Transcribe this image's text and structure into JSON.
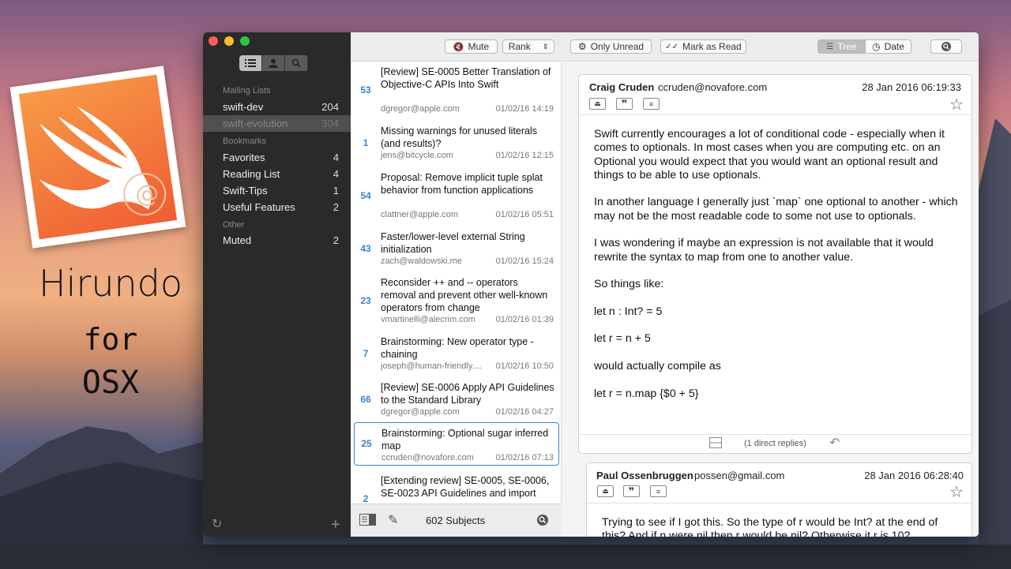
{
  "hero": {
    "line1": "Hirundo",
    "line2": "for",
    "line3": "OSX"
  },
  "sidebar": {
    "sections": {
      "mailing": "Mailing Lists",
      "bookmarks": "Bookmarks",
      "other": "Other"
    },
    "mailing": [
      {
        "label": "swift-dev",
        "count": "204"
      },
      {
        "label": "swift-evolution",
        "count": "304"
      }
    ],
    "bookmarks": [
      {
        "label": "Favorites",
        "count": "4"
      },
      {
        "label": "Reading List",
        "count": "4"
      },
      {
        "label": "Swift-Tips",
        "count": "1"
      },
      {
        "label": "Useful Features",
        "count": "2"
      }
    ],
    "other": [
      {
        "label": "Muted",
        "count": "2"
      }
    ]
  },
  "list_toolbar": {
    "mute": "Mute",
    "rank": "Rank"
  },
  "threads": [
    {
      "count": "53",
      "subject": "[Review] SE-0005 Better Translation of Objective-C APIs Into Swift",
      "from": "dgregor@apple.com",
      "date": "01/02/16 14:19"
    },
    {
      "count": "1",
      "subject": "Missing warnings for unused literals (and results)?",
      "from": "jens@bitcycle.com",
      "date": "01/02/16 12:15"
    },
    {
      "count": "54",
      "subject": "Proposal: Remove implicit tuple splat behavior from function applications",
      "from": "clattner@apple.com",
      "date": "01/02/16 05:51"
    },
    {
      "count": "43",
      "subject": "Faster/lower-level external String initialization",
      "from": "zach@waldowski.me",
      "date": "01/02/16 15:24"
    },
    {
      "count": "23",
      "subject": "Reconsider ++ and -- operators removal and prevent other well-known operators from change",
      "from": "vmartinelli@alecrim.com",
      "date": "01/02/16 01:39"
    },
    {
      "count": "7",
      "subject": "Brainstorming: New operator type - chaining",
      "from": "joseph@human-friendly....",
      "date": "01/02/16 10:50"
    },
    {
      "count": "66",
      "subject": "[Review] SE-0006 Apply API Guidelines to the Standard Library",
      "from": "dgregor@apple.com",
      "date": "01/02/16 04:27"
    },
    {
      "count": "25",
      "subject": "Brainstorming: Optional sugar inferred map",
      "from": "ccruden@novafore.com",
      "date": "01/02/16 07:13"
    },
    {
      "count": "2",
      "subject": "[Extending review] SE-0005, SE-0006, SE-0023 API Guidelines and import",
      "from": "",
      "date": ""
    }
  ],
  "list_footer": {
    "subjects": "602 Subjects"
  },
  "main_toolbar": {
    "only_unread": "Only Unread",
    "mark_read": "Mark as Read",
    "tree": "Tree",
    "date": "Date"
  },
  "messages": [
    {
      "name": "Craig Cruden",
      "email": "ccruden@novafore.com",
      "date": "28 Jan 2016 06:19:33",
      "paragraphs": [
        "Swift currently encourages a lot of conditional code - especially when it comes to optionals. In most cases when you are computing etc. on an Optional you would expect that you would want an optional result and things to be able to use optionals.",
        "In another language I generally just `map` one optional to another - which may not be the most readable code to some not use to optionals.",
        "I was wondering if maybe an expression is not available that it would rewrite the syntax to map from one to another value.",
        "So things like:",
        "let n : Int? = 5",
        "let r = n + 5",
        "would actually compile as",
        "let r = n.map {$0 + 5}"
      ],
      "replies": "(1 direct replies)"
    },
    {
      "name": "Paul Ossenbruggen",
      "email": "possen@gmail.com",
      "date": "28 Jan 2016 06:28:40",
      "paragraphs": [
        "Trying to see if I got this. So the type of r would be Int? at the end of this? And if n were nil then r would be nil? Otherwise it r is 10?"
      ]
    }
  ]
}
